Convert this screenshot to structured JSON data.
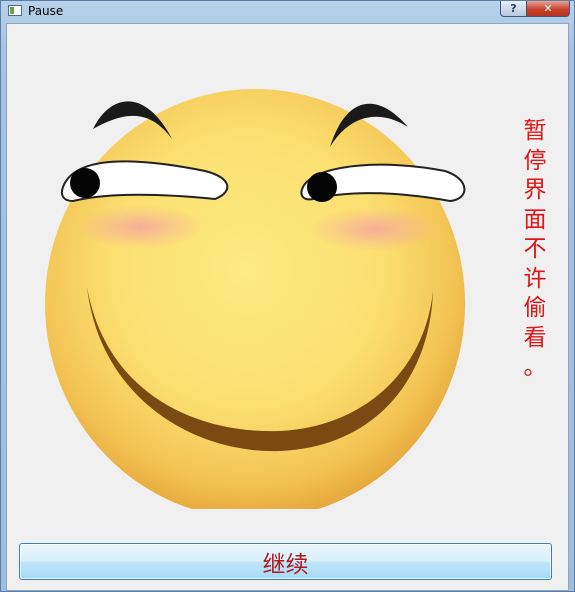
{
  "window": {
    "title": "Pause",
    "buttons": {
      "help_label": "?",
      "close_label": "✕"
    }
  },
  "main": {
    "side_text": [
      "暂",
      "停",
      "界",
      "面",
      "不",
      "许",
      "偷",
      "看",
      "。"
    ],
    "side_text_color": "#e01515",
    "face_image": "smirking-smiley-face",
    "continue_button_label": "继续",
    "continue_button_text_color": "#b01818"
  }
}
